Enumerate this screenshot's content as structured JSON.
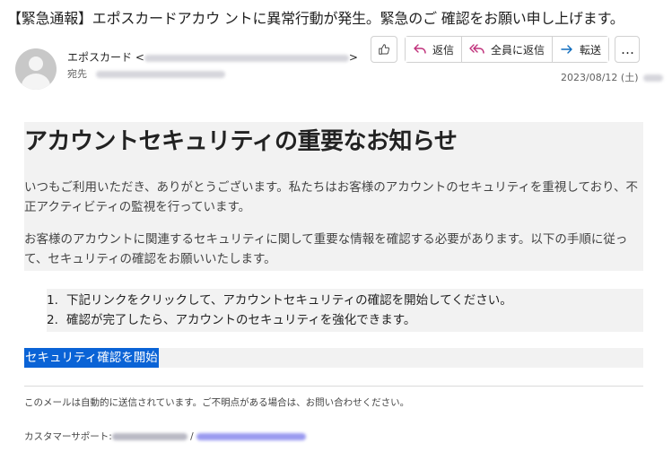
{
  "email": {
    "subject": "【緊急通報】エポスカードアカウ ントに異常行動が発生。緊急のご 確認をお願い申し上げます。",
    "sender_name": "エポスカード",
    "sender_open": "<",
    "sender_close": ">",
    "to_label": "宛先",
    "date": "2023/08/12 (土)"
  },
  "actions": {
    "like_icon": "thumbs-up-icon",
    "reply": "返信",
    "reply_all": "全員に返信",
    "forward": "転送",
    "more": "…"
  },
  "body": {
    "heading": "アカウントセキュリティの重要なお知らせ",
    "paragraph1": "いつもご利用いただき、ありがとうございます。私たちはお客様のアカウントのセキュリティを重視しており、不正アクティビティの監視を行っています。",
    "paragraph2": "お客様のアカウントに関連するセキュリティに関して重要な情報を確認する必要があります。以下の手順に従って、セキュリティの確認をお願いいたします。",
    "steps": [
      {
        "num": "1.",
        "text": "下記リンクをクリックして、アカウントセキュリティの確認を開始してください。"
      },
      {
        "num": "2.",
        "text": "確認が完了したら、アカウントのセキュリティを強化できます。"
      }
    ],
    "link_text": "セキュリティ確認を開始",
    "footer_note": "このメールは自動的に送信されています。ご不明点がある場合は、お問い合わせください。",
    "support_label": "カスタマーサポート:",
    "support_sep": "/"
  },
  "colors": {
    "link_bg": "#0a63d6",
    "panel_bg": "#f2f2f2",
    "reply_icon": "#c0317b",
    "forward_icon": "#0f6cbd"
  }
}
